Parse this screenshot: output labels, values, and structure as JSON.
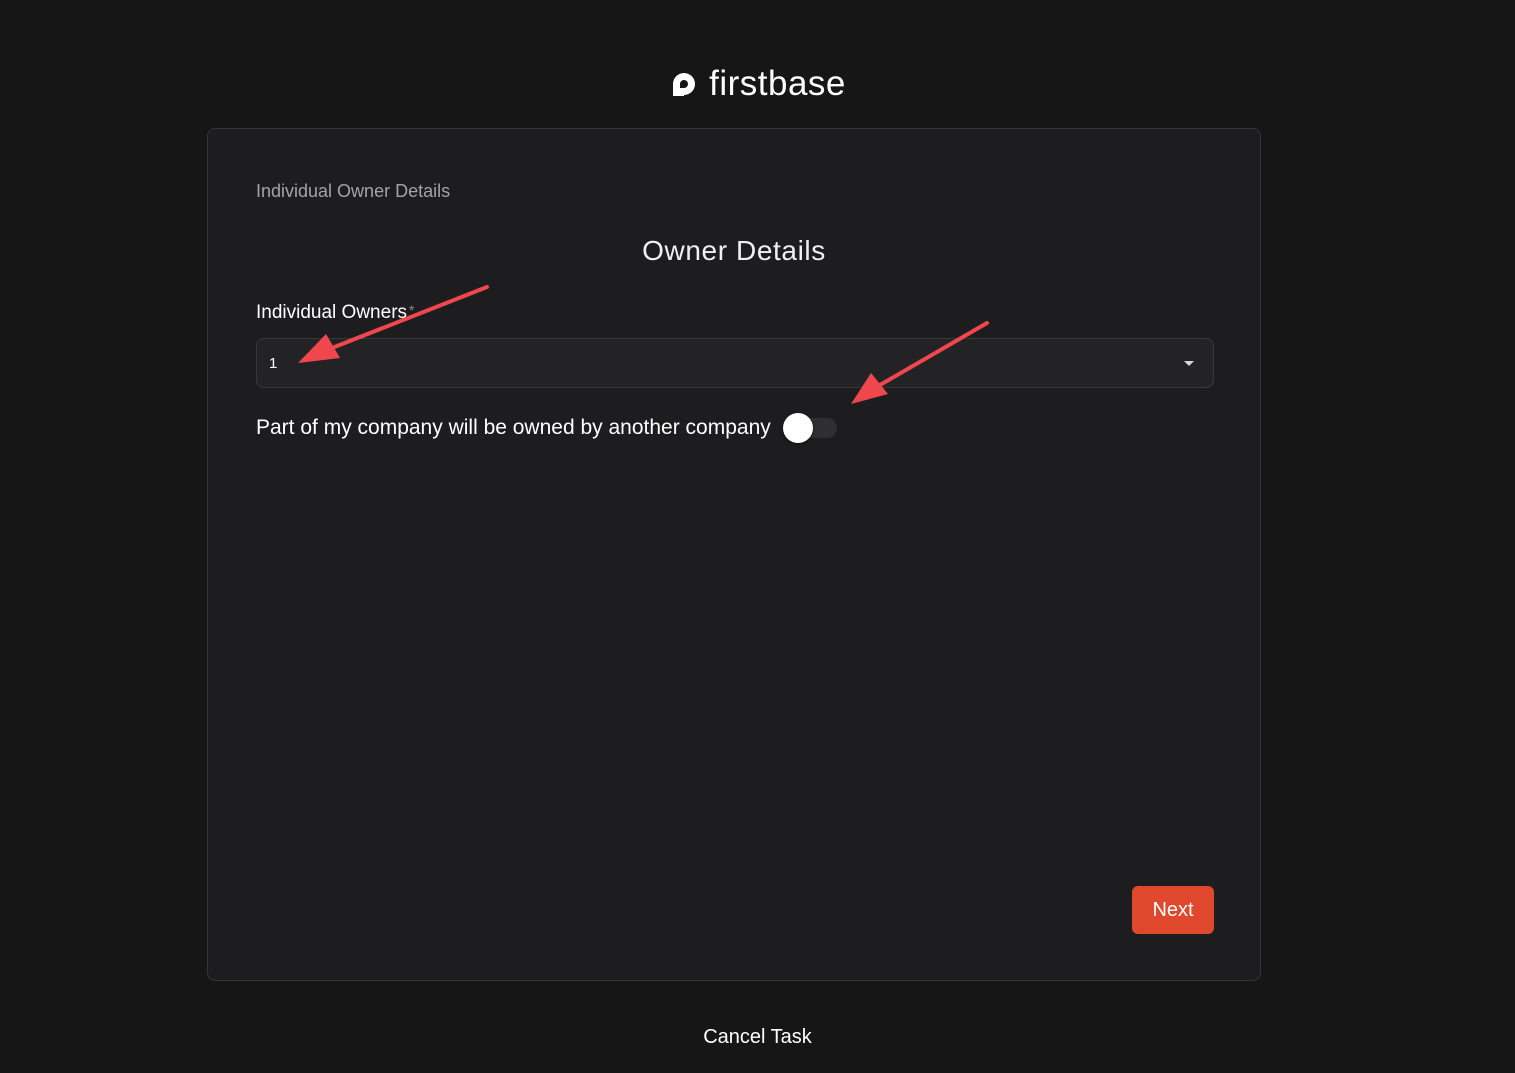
{
  "brand": {
    "name": "firstbase",
    "logo_icon": "firstbase-logo-icon"
  },
  "card": {
    "step_label": "Individual Owner Details",
    "title": "Owner Details",
    "owners_field": {
      "label": "Individual Owners",
      "required_marker": "*",
      "value": "1",
      "icon": "caret-down-icon"
    },
    "company_owner_toggle": {
      "label": "Part of my company will be owned by another company",
      "checked": false
    },
    "next_label": "Next"
  },
  "footer": {
    "cancel_label": "Cancel Task"
  },
  "colors": {
    "background": "#161617",
    "card": "#1d1d1f",
    "accent": "#e0482d",
    "annotation_arrow": "#f0474f"
  },
  "annotations": {
    "arrow_icon": "annotation-arrow-icon"
  }
}
